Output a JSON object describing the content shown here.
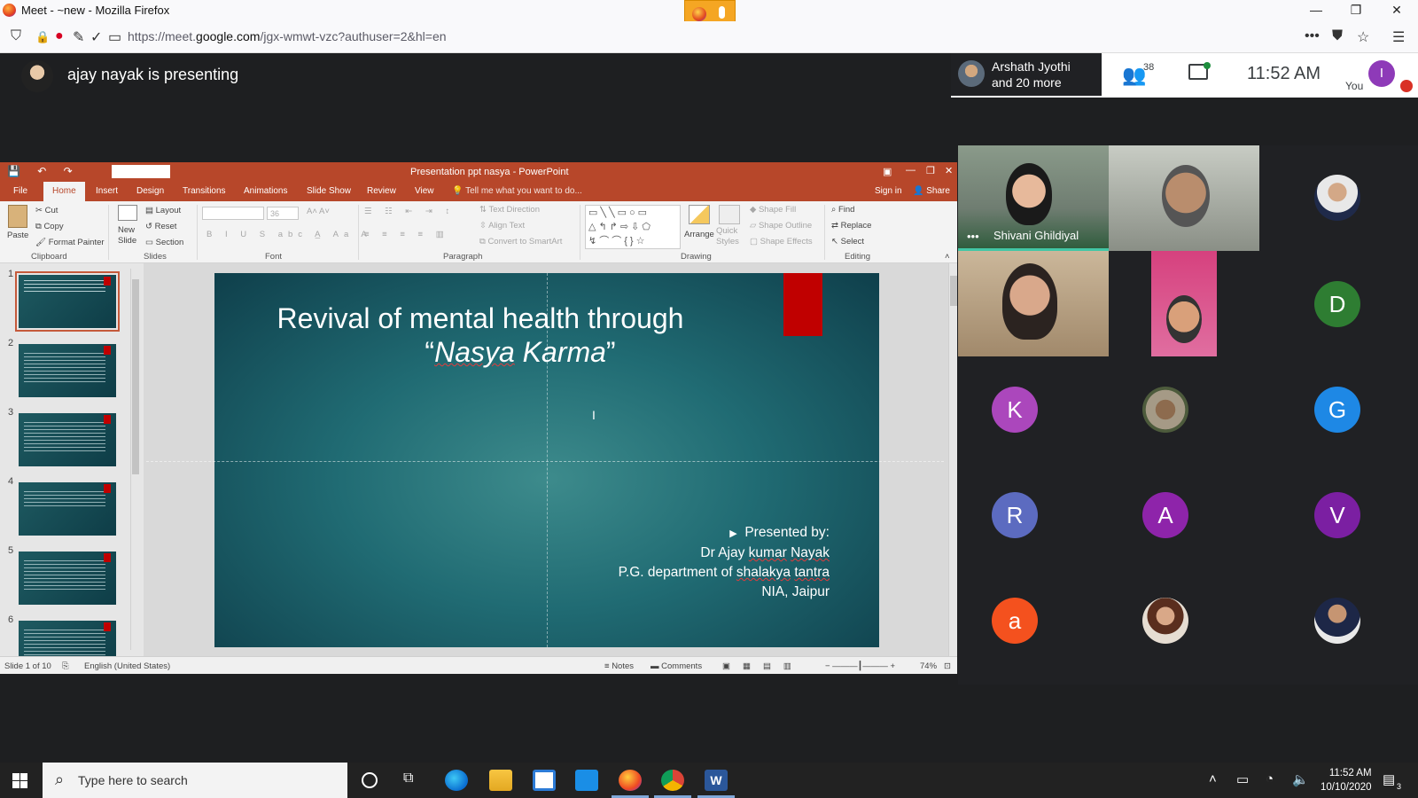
{
  "browser": {
    "window_title": "Meet - ~new - Mozilla Firefox",
    "url_prefix": "https://meet.",
    "url_domain": "google.com",
    "url_rest": "/jgx-wmwt-vzc?authuser=2&hl=en",
    "min": "—",
    "max": "❐",
    "close": "✕",
    "nav_shield": "⛉",
    "nav_lock": "🔒",
    "nav_more": "•••",
    "nav_pocket": "⛊",
    "nav_star": "☆",
    "nav_menu": "☰"
  },
  "meet": {
    "presenting_label": "ajay nayak is presenting",
    "participants_preview_line1": "Arshath Jyothi",
    "participants_preview_line2": "and 20 more",
    "people_count": "38",
    "clock": "11:52 AM",
    "you_initial": "I",
    "you_label": "You",
    "tiles": [
      {
        "type": "video",
        "name": "Shivani Ghildiyal",
        "more": "•••"
      },
      {
        "type": "video",
        "name": ""
      },
      {
        "type": "photo",
        "name": ""
      },
      {
        "type": "video",
        "name": ""
      },
      {
        "type": "video",
        "name": ""
      },
      {
        "type": "initial",
        "initial": "D",
        "color": "#2e7d32"
      },
      {
        "type": "initial",
        "initial": "K",
        "color": "#ab47bc"
      },
      {
        "type": "photo",
        "name": ""
      },
      {
        "type": "initial",
        "initial": "G",
        "color": "#1e88e5"
      },
      {
        "type": "initial",
        "initial": "R",
        "color": "#5c6bc0"
      },
      {
        "type": "initial",
        "initial": "A",
        "color": "#8e24aa"
      },
      {
        "type": "initial",
        "initial": "V",
        "color": "#7b1fa2"
      },
      {
        "type": "initial",
        "initial": "a",
        "color": "#f4511e"
      },
      {
        "type": "photo",
        "name": ""
      },
      {
        "type": "photo",
        "name": ""
      }
    ]
  },
  "ppt": {
    "title": "Presentation ppt nasya - PowerPoint",
    "qat": "💾 ↶ ↷",
    "tabs": [
      "File",
      "Home",
      "Insert",
      "Design",
      "Transitions",
      "Animations",
      "Slide Show",
      "Review",
      "View"
    ],
    "tell_me": "Tell me what you want to do...",
    "sign_in": "Sign in",
    "share": "Share",
    "ribbon": {
      "paste": "Paste",
      "cut": "Cut",
      "copy": "Copy",
      "format_painter": "Format Painter",
      "new_slide": "New Slide",
      "layout": "Layout",
      "reset": "Reset",
      "section": "Section",
      "font_size": "36",
      "text_direction": "Text Direction",
      "align_text": "Align Text",
      "convert_smartart": "Convert to SmartArt",
      "arrange": "Arrange",
      "quick_styles": "Quick Styles",
      "shape_fill": "Shape Fill",
      "shape_outline": "Shape Outline",
      "shape_effects": "Shape Effects",
      "find": "Find",
      "replace": "Replace",
      "select": "Select",
      "groups": {
        "clipboard": "Clipboard",
        "slides": "Slides",
        "font": "Font",
        "paragraph": "Paragraph",
        "drawing": "Drawing",
        "editing": "Editing"
      }
    },
    "thumbnails": [
      "1",
      "2",
      "3",
      "4",
      "5",
      "6"
    ],
    "slide": {
      "title_line1": "Revival of mental health through",
      "title_q_open": "“",
      "title_italic_1": "Nasya",
      "title_italic_2": " Karma",
      "title_q_close": "”",
      "presented_by": "Presented by:",
      "author_prefix": "Dr Ajay ",
      "author_u1": "kumar",
      "author_mid": " ",
      "author_u2": "Nayak",
      "dept_prefix": "P.G. department of ",
      "dept_u1": "shalakya",
      "dept_mid": " ",
      "dept_u2": "tantra",
      "institute": "NIA, Jaipur"
    },
    "status": {
      "slide_count": "Slide 1 of 10",
      "language": "English (United States)",
      "notes": "Notes",
      "comments": "Comments",
      "zoom": "74%"
    }
  },
  "taskbar": {
    "search_placeholder": "Type here to search",
    "time": "11:52 AM",
    "date": "10/10/2020",
    "notif_count": "3"
  }
}
